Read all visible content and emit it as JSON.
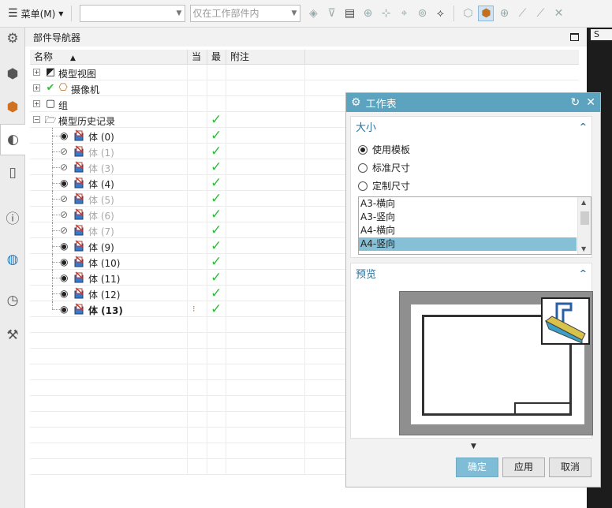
{
  "toolbar": {
    "menu_label": "菜单(M)",
    "combo1_value": "",
    "combo2_placeholder": "仅在工作部件内"
  },
  "navigator": {
    "title": "部件导航器",
    "columns": {
      "name": "名称",
      "current": "当",
      "latest": "最",
      "notes": "附注"
    },
    "nodes": [
      {
        "label": "模型视图",
        "icon": "model-views-icon"
      },
      {
        "label": "摄像机",
        "icon": "camera-icon"
      },
      {
        "label": "组",
        "icon": "group-icon"
      },
      {
        "label": "模型历史记录",
        "icon": "history-folder-icon"
      }
    ],
    "bodies": [
      {
        "label": "体 (0)",
        "visible": true
      },
      {
        "label": "体 (1)",
        "visible": false
      },
      {
        "label": "体 (3)",
        "visible": false
      },
      {
        "label": "体 (4)",
        "visible": true
      },
      {
        "label": "体 (5)",
        "visible": false
      },
      {
        "label": "体 (6)",
        "visible": false
      },
      {
        "label": "体 (7)",
        "visible": false
      },
      {
        "label": "体 (9)",
        "visible": true
      },
      {
        "label": "体 (10)",
        "visible": true
      },
      {
        "label": "体 (11)",
        "visible": true
      },
      {
        "label": "体 (12)",
        "visible": true
      },
      {
        "label": "体 (13)",
        "visible": true,
        "current": true
      }
    ]
  },
  "rightstrip": {
    "tab_label": "S"
  },
  "dialog": {
    "title": "工作表",
    "size_section": {
      "title": "大小",
      "options": [
        "使用模板",
        "标准尺寸",
        "定制尺寸"
      ],
      "selected_option": "使用模板",
      "templates": [
        "A3-横向",
        "A3-竖向",
        "A4-横向",
        "A4-竖向"
      ],
      "selected_template": "A4-竖向"
    },
    "preview_section": {
      "title": "预览"
    },
    "buttons": {
      "ok": "确定",
      "apply": "应用",
      "cancel": "取消"
    }
  },
  "colors": {
    "dialog_title_bar": "#5ba3be",
    "section_header_text": "#2d6f99",
    "list_selection": "#86c0d6",
    "check_green": "#2fbf3a",
    "primary_button": "#7fbcd6"
  }
}
